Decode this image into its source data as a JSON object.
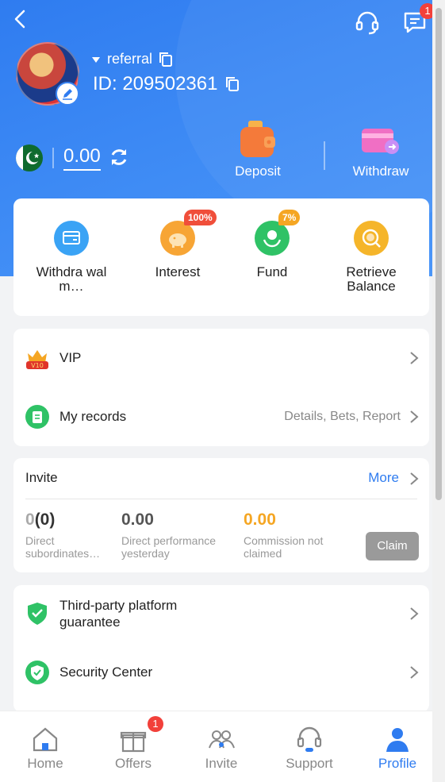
{
  "header": {
    "back_icon": "back-arrow-icon",
    "support_icon": "headset-icon",
    "messages_icon": "message-icon",
    "messages_badge": "1"
  },
  "profile": {
    "referral_label": "referral",
    "id_text": "ID: 209502361"
  },
  "wallet": {
    "balance": "0.00",
    "deposit_label": "Deposit",
    "withdraw_label": "Withdraw"
  },
  "quick_actions": [
    {
      "label": "Withdra wal m…",
      "icon": "wallet-card-icon"
    },
    {
      "label": "Interest",
      "icon": "piggy-bank-icon",
      "badge": "100%"
    },
    {
      "label": "Fund",
      "icon": "fund-icon",
      "badge": "7%"
    },
    {
      "label": "Retrieve Balance",
      "icon": "coin-search-icon"
    }
  ],
  "menu": {
    "vip_label": "VIP",
    "vip_level": "V10",
    "records_label": "My records",
    "records_hint": "Details, Bets, Report"
  },
  "invite": {
    "title": "Invite",
    "more": "More",
    "stats": [
      {
        "value_prefix": "0",
        "value_paren": "(0)",
        "label": "Direct subordinates…"
      },
      {
        "value": "0.00",
        "label": "Direct performance yesterday"
      },
      {
        "value": "0.00",
        "label": "Commission not claimed"
      }
    ],
    "claim": "Claim"
  },
  "misc": {
    "guarantee_label": "Third-party platform guarantee",
    "security_label": "Security Center"
  },
  "tabs": [
    {
      "label": "Home",
      "icon": "home-icon"
    },
    {
      "label": "Offers",
      "icon": "gift-icon",
      "badge": "1"
    },
    {
      "label": "Invite",
      "icon": "people-icon"
    },
    {
      "label": "Support",
      "icon": "headset-icon"
    },
    {
      "label": "Profile",
      "icon": "user-icon",
      "active": true
    }
  ],
  "colors": {
    "primary": "#2f7cf0",
    "badge_red": "#f2403a",
    "commission_orange": "#f5a623"
  }
}
